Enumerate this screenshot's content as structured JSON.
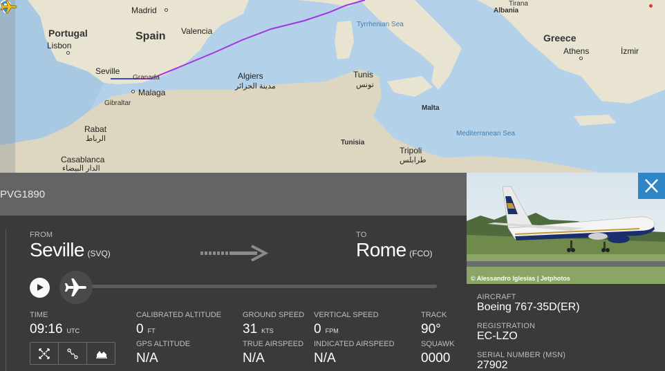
{
  "map": {
    "labels": {
      "madrid": "Madrid",
      "portugal": "Portugal",
      "lisbon": "Lisbon",
      "spain": "Spain",
      "valencia": "Valencia",
      "seville": "Seville",
      "granada": "Granada",
      "malaga": "Malaga",
      "gibraltar": "Gibraltar",
      "rabat": "Rabat",
      "rabat_ar": "الرباط",
      "casablanca": "Casablanca",
      "casablanca_ar": "الدار البيضاء",
      "algiers": "Algiers",
      "algiers_ar": "مدينة الجزائر",
      "tunis": "Tunis",
      "tunis_ar": "تونس",
      "tunisia": "Tunisia",
      "tripoli": "Tripoli",
      "tripoli_ar": "طرابلس",
      "malta": "Malta",
      "tyrrhenian_sea": "Tyrrhenian Sea",
      "mediterranean_sea": "Mediterranean Sea",
      "albania": "Albania",
      "tirana": "Tirana",
      "greece": "Greece",
      "athens": "Athens",
      "izmir": "İzmir"
    },
    "route_color": "#a333e0"
  },
  "flight": {
    "callsign": "PVG1890",
    "from_label": "FROM",
    "from_city": "Seville",
    "from_code": "(SVQ)",
    "to_label": "TO",
    "to_city": "Rome",
    "to_code": "(FCO)",
    "progress": 0.0
  },
  "stats": {
    "time_label": "TIME",
    "time_value": "09:16",
    "time_unit": "UTC",
    "cal_alt_label": "CALIBRATED ALTITUDE",
    "cal_alt_value": "0",
    "cal_alt_unit": "FT",
    "gps_alt_label": "GPS ALTITUDE",
    "gps_alt_value": "N/A",
    "ground_speed_label": "GROUND SPEED",
    "ground_speed_value": "31",
    "ground_speed_unit": "KTS",
    "true_airspeed_label": "TRUE AIRSPEED",
    "true_airspeed_value": "N/A",
    "vertical_speed_label": "VERTICAL SPEED",
    "vertical_speed_value": "0",
    "vertical_speed_unit": "FPM",
    "indicated_airspeed_label": "INDICATED AIRSPEED",
    "indicated_airspeed_value": "N/A",
    "track_label": "TRACK",
    "track_value": "90°",
    "squawk_label": "SQUAWK",
    "squawk_value": "0000"
  },
  "aircraft": {
    "photo_credit": "© Alessandro Iglesias | Jetphotos",
    "aircraft_label": "AIRCRAFT",
    "aircraft_value": "Boeing 767-35D(ER)",
    "registration_label": "REGISTRATION",
    "registration_value": "EC-LZO",
    "serial_label": "SERIAL NUMBER (MSN)",
    "serial_value": "27902"
  },
  "icons": {
    "close": "close-icon",
    "play": "play-icon",
    "plane": "plane-icon",
    "follow": "follow-icon",
    "route": "route-icon",
    "graph": "graph-icon",
    "arrow": "arrow-right-icon",
    "pin": "map-pin-icon"
  },
  "colors": {
    "accent": "#2f86c7",
    "route": "#a333e0",
    "aircraft_marker": "#f5c518",
    "panel": "#3a3a3a",
    "title_bar": "#646464"
  }
}
